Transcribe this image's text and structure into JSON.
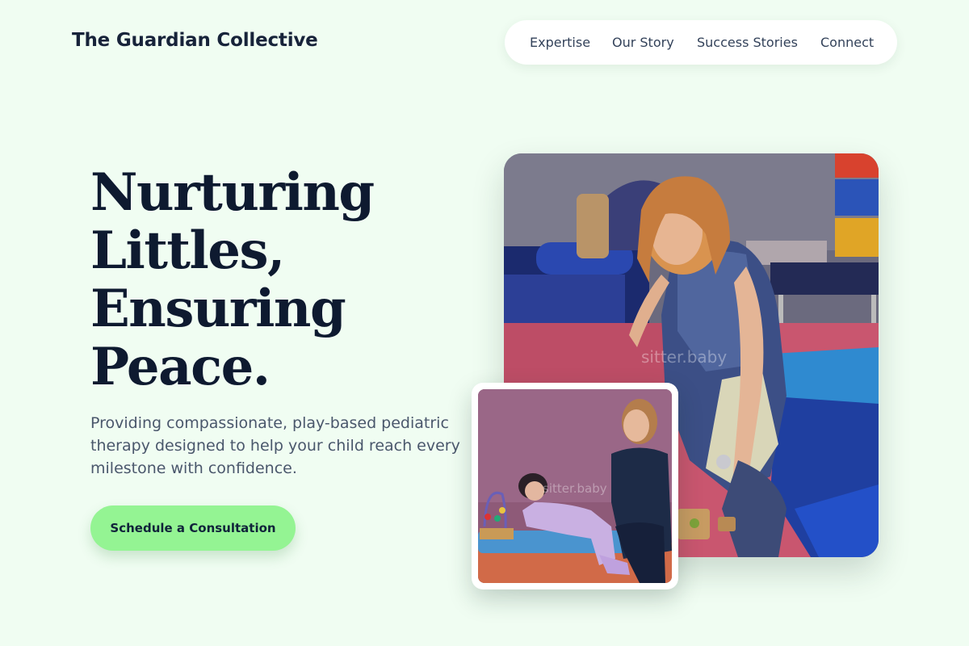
{
  "brand": {
    "name": "The Guardian Collective"
  },
  "nav": {
    "items": [
      {
        "label": "Expertise"
      },
      {
        "label": "Our Story"
      },
      {
        "label": "Success Stories"
      },
      {
        "label": "Connect"
      }
    ]
  },
  "hero": {
    "headline_lines": [
      "Nurturing",
      "Littles,",
      "Ensuring",
      "Peace."
    ],
    "subtitle": "Providing compassionate, play-based pediatric therapy designed to help your child reach every milestone with confidence.",
    "cta_label": "Schedule a Consultation"
  },
  "images": {
    "main_photo_subject": "therapist-playing-with-blocks-on-foam-mat",
    "small_photo_subject": "therapist-with-child-on-therapy-bench",
    "watermark_main": "sitter.baby",
    "watermark_small": "sitter.baby"
  },
  "colors": {
    "background": "#f0fdf2",
    "accent": "#94f493",
    "heading": "#0e1a30",
    "body_text": "#4a576c",
    "nav_bg": "#ffffff"
  }
}
